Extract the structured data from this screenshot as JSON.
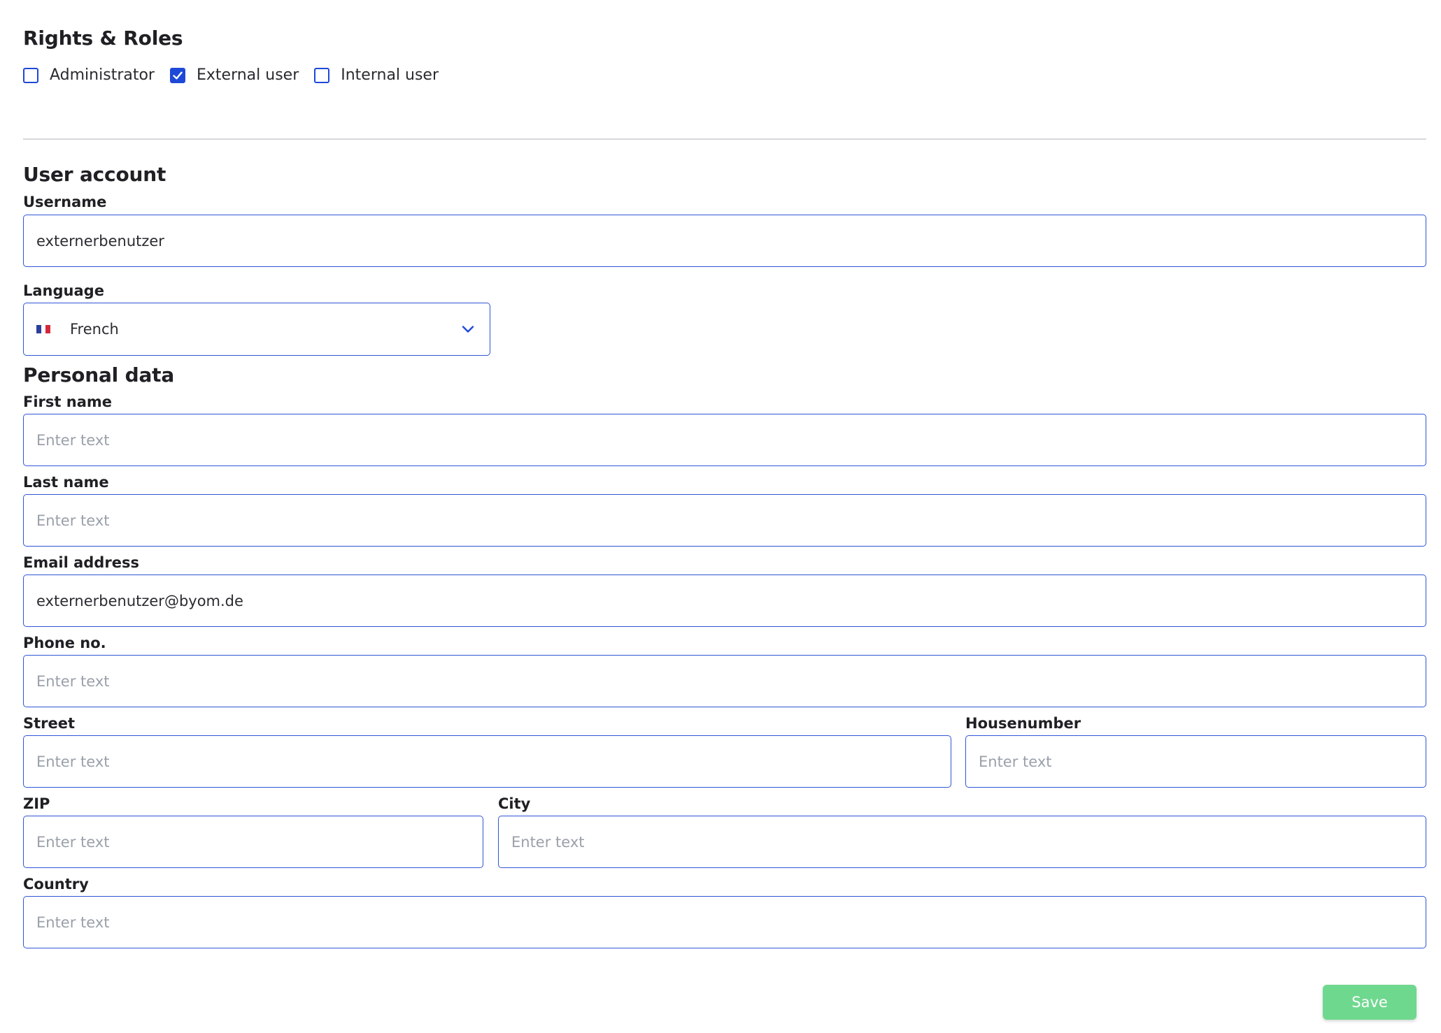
{
  "rights": {
    "title": "Rights & Roles",
    "roles": [
      {
        "label": "Administrator",
        "checked": false
      },
      {
        "label": "External user",
        "checked": true
      },
      {
        "label": "Internal user",
        "checked": false
      }
    ]
  },
  "account": {
    "title": "User account",
    "username": {
      "label": "Username",
      "value": "externerbenutzer"
    },
    "language": {
      "label": "Language",
      "value": "French",
      "flag_icon": "flag-france-icon"
    }
  },
  "personal": {
    "title": "Personal data",
    "first_name": {
      "label": "First name",
      "value": "",
      "placeholder": "Enter text"
    },
    "last_name": {
      "label": "Last name",
      "value": "",
      "placeholder": "Enter text"
    },
    "email": {
      "label": "Email address",
      "value": "externerbenutzer@byom.de",
      "placeholder": "Enter text"
    },
    "phone": {
      "label": "Phone no.",
      "value": "",
      "placeholder": "Enter text"
    },
    "street": {
      "label": "Street",
      "value": "",
      "placeholder": "Enter text"
    },
    "housenumber": {
      "label": "Housenumber",
      "value": "",
      "placeholder": "Enter text"
    },
    "zip": {
      "label": "ZIP",
      "value": "",
      "placeholder": "Enter text"
    },
    "city": {
      "label": "City",
      "value": "",
      "placeholder": "Enter text"
    },
    "country": {
      "label": "Country",
      "value": "",
      "placeholder": "Enter text"
    }
  },
  "actions": {
    "save_label": "Save"
  },
  "colors": {
    "accent": "#1e49d8",
    "input_border": "#2f56d6",
    "save_button": "#6fd88f",
    "divider": "#d8d8dc"
  }
}
